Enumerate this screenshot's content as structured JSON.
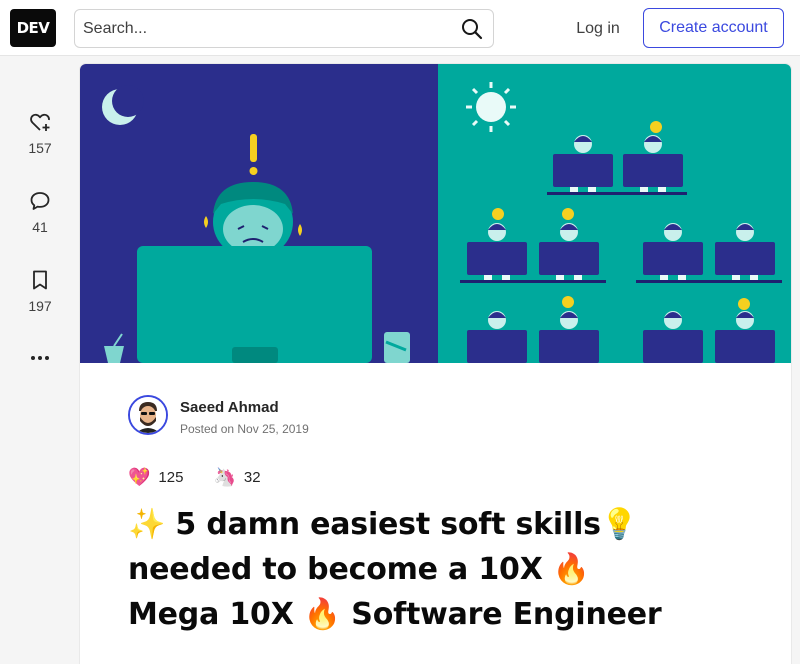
{
  "header": {
    "logo_text": "DEV",
    "search": {
      "placeholder": "Search..."
    },
    "login_label": "Log in",
    "create_account_label": "Create account",
    "accent_color": "#3b49df"
  },
  "sidebar": {
    "reactions": {
      "icon": "heart-plus-icon",
      "count": "157"
    },
    "comments": {
      "icon": "comment-icon",
      "count": "41"
    },
    "bookmarks": {
      "icon": "bookmark-icon",
      "count": "197"
    },
    "more": {
      "icon": "more-icon"
    }
  },
  "article": {
    "author": {
      "name": "Saeed Ahmad",
      "posted_label": "Posted on",
      "date": "Nov 25, 2019"
    },
    "reactions": [
      {
        "icon": "💖",
        "count": "125"
      },
      {
        "icon": "🦄",
        "count": "32"
      }
    ],
    "title": "✨ 5 damn easiest soft skills💡 needed to become a 10X 🔥 Mega 10X 🔥 Software Engineer",
    "cover_colors": {
      "night": "#2b2e8c",
      "day": "#00a99d"
    }
  }
}
